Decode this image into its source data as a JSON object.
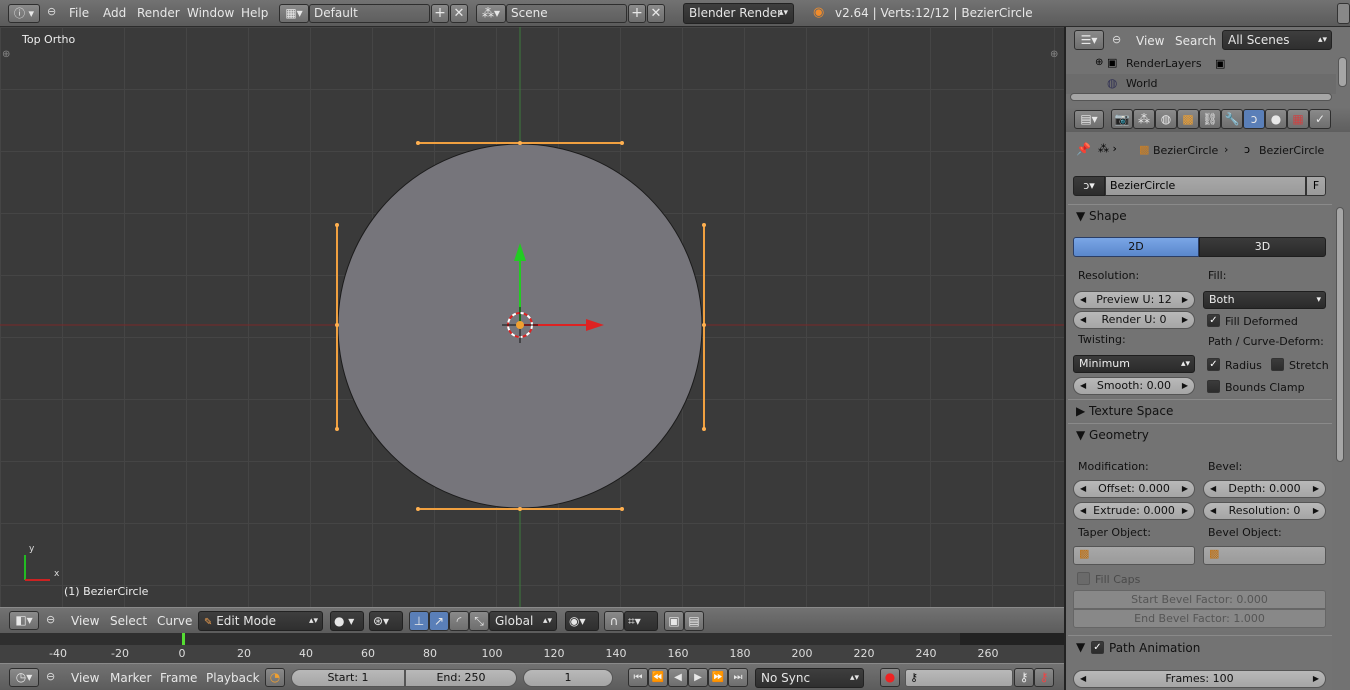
{
  "topbar": {
    "menus": [
      "File",
      "Add",
      "Render",
      "Window",
      "Help"
    ],
    "screen_layout": "Default",
    "scene": "Scene",
    "render_engine": "Blender Render",
    "info": "v2.64 | Verts:12/12 | BezierCircle"
  },
  "viewport": {
    "view_name": "Top Ortho",
    "object_label": "(1) BezierCircle",
    "axis_y": "y",
    "axis_x": "x"
  },
  "viewport_header": {
    "menus": [
      "View",
      "Select",
      "Curve"
    ],
    "mode": "Edit Mode",
    "orientation": "Global"
  },
  "timeline": {
    "ticks": [
      "-40",
      "-20",
      "0",
      "20",
      "40",
      "60",
      "80",
      "100",
      "120",
      "140",
      "160",
      "180",
      "200",
      "220",
      "240",
      "260"
    ],
    "current_frame_marker": 0
  },
  "timeline_header": {
    "menus": [
      "View",
      "Marker",
      "Frame",
      "Playback"
    ],
    "start": "Start: 1",
    "end": "End: 250",
    "current": "1",
    "sync": "No Sync"
  },
  "outliner": {
    "menus": [
      "View",
      "Search"
    ],
    "filter": "All Scenes",
    "items": [
      "RenderLayers",
      "World"
    ]
  },
  "properties": {
    "breadcrumb_object": "BezierCircle",
    "breadcrumb_data": "BezierCircle",
    "datablock_name": "BezierCircle",
    "fake_user": "F",
    "shape": {
      "title": "Shape",
      "tab_2d": "2D",
      "tab_3d": "3D",
      "resolution_label": "Resolution:",
      "preview_u": "Preview U: 12",
      "render_u": "Render U: 0",
      "twisting_label": "Twisting:",
      "twisting_value": "Minimum",
      "smooth": "Smooth: 0.00",
      "fill_label": "Fill:",
      "fill_value": "Both",
      "fill_deformed": "Fill Deformed",
      "path_label": "Path / Curve-Deform:",
      "radius": "Radius",
      "stretch": "Stretch",
      "bounds_clamp": "Bounds Clamp"
    },
    "texture_space": {
      "title": "Texture Space"
    },
    "geometry": {
      "title": "Geometry",
      "modification_label": "Modification:",
      "offset": "Offset: 0.000",
      "extrude": "Extrude: 0.000",
      "bevel_label": "Bevel:",
      "depth": "Depth: 0.000",
      "resolution": "Resolution: 0",
      "taper_label": "Taper Object:",
      "bevel_object_label": "Bevel Object:",
      "fill_caps": "Fill Caps",
      "start_bevel": "Start Bevel Factor: 0.000",
      "end_bevel": "End Bevel Factor: 1.000"
    },
    "path_animation": {
      "title": "Path Animation",
      "frames": "Frames: 100"
    }
  }
}
